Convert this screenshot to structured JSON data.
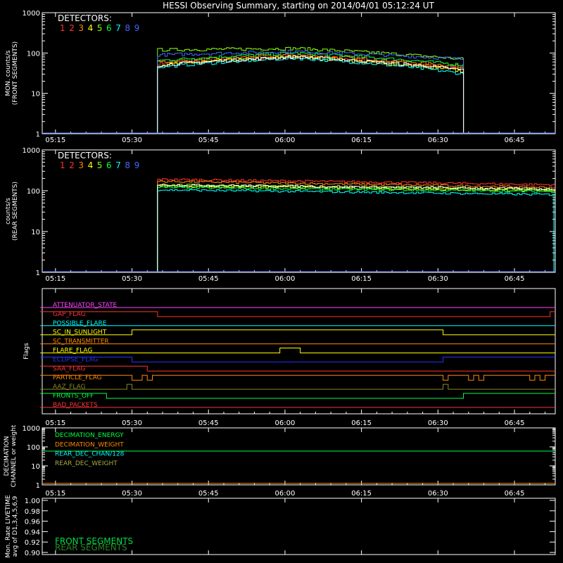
{
  "title": "HESSI Observing Summary, starting on 2014/04/01 05:12:24 UT",
  "colors": {
    "background": "#000000",
    "frame": "#ffffff",
    "detectors": [
      "#ff3333",
      "#ff3333",
      "#ff8800",
      "#ffff00",
      "#88ff00",
      "#00ff44",
      "#00ffff",
      "#4466ff",
      "#4466ff"
    ]
  },
  "time_ticks": [
    "05:15",
    "05:30",
    "05:45",
    "06:00",
    "06:15",
    "06:30",
    "06:45"
  ],
  "front_panel": {
    "ylabel_line1": "MON. counts/s",
    "ylabel_line2": "(FRONT SEGMENTS)",
    "yticks": [
      "1000",
      "100",
      "10",
      "1"
    ],
    "legend_title": "DETECTORS:",
    "detector_numbers": [
      "1",
      "2",
      "3",
      "4",
      "5",
      "6",
      "7",
      "8",
      "9"
    ],
    "chart_data": {
      "type": "line",
      "x_range": [
        "05:12",
        "06:53"
      ],
      "ylim": [
        1,
        1000
      ],
      "log_scale": true,
      "data_start": "05:35",
      "data_end": "06:35",
      "series_levels": [
        {
          "color": "#ff3333",
          "start": 55,
          "peak": 85,
          "end": 40
        },
        {
          "color": "#ff8800",
          "start": 60,
          "peak": 90,
          "end": 45
        },
        {
          "color": "#ffff00",
          "start": 50,
          "peak": 80,
          "end": 35
        },
        {
          "color": "#88ff00",
          "start": 120,
          "peak": 130,
          "end": 70
        },
        {
          "color": "#00ff44",
          "start": 65,
          "peak": 100,
          "end": 50
        },
        {
          "color": "#00ffff",
          "start": 45,
          "peak": 75,
          "end": 30
        },
        {
          "color": "#4466ff",
          "start": 90,
          "peak": 110,
          "end": 70
        },
        {
          "color": "#ffffff",
          "start": 50,
          "peak": 80,
          "end": 38
        }
      ]
    }
  },
  "rear_panel": {
    "ylabel_line1": "counts/s",
    "ylabel_line2": "(REAR SEGMENTS)",
    "yticks": [
      "1000",
      "100",
      "10",
      "1"
    ],
    "legend_title": "DETECTORS:",
    "detector_numbers": [
      "1",
      "2",
      "3",
      "4",
      "5",
      "6",
      "7",
      "8",
      "9"
    ],
    "chart_data": {
      "type": "line",
      "x_range": [
        "05:12",
        "06:53"
      ],
      "ylim": [
        1,
        1000
      ],
      "log_scale": true,
      "data_start": "05:35",
      "series_levels": [
        {
          "color": "#ff3333",
          "start": 190,
          "end": 140
        },
        {
          "color": "#ff8800",
          "start": 170,
          "end": 120
        },
        {
          "color": "#ffff00",
          "start": 130,
          "end": 100
        },
        {
          "color": "#88ff00",
          "start": 140,
          "end": 105
        },
        {
          "color": "#00ff44",
          "start": 120,
          "end": 95
        },
        {
          "color": "#00ffff",
          "start": 105,
          "end": 80
        },
        {
          "color": "#ffffff",
          "start": 140,
          "end": 110
        }
      ]
    }
  },
  "flags_panel": {
    "ylabel": "Flags",
    "flags": [
      {
        "label": "ATTENUATOR_STATE",
        "color": "#ff44ff",
        "segments": [
          [
            "05:12",
            "06:53",
            0
          ]
        ]
      },
      {
        "label": "GAP_FLAG",
        "color": "#ff3333",
        "segments": [
          [
            "05:12",
            "05:35",
            1
          ],
          [
            "05:35",
            "06:52",
            0
          ],
          [
            "06:52",
            "06:53",
            1
          ]
        ]
      },
      {
        "label": "POSSIBLE_FLARE",
        "color": "#00ffff",
        "segments": [
          [
            "05:12",
            "06:53",
            0
          ]
        ]
      },
      {
        "label": "SC_IN_SUNLIGHT",
        "color": "#ffff00",
        "segments": [
          [
            "05:12",
            "05:30",
            0
          ],
          [
            "05:30",
            "06:31",
            1
          ],
          [
            "06:31",
            "06:53",
            0
          ]
        ]
      },
      {
        "label": "SC_TRANSMITTER",
        "color": "#ff8800",
        "segments": [
          [
            "05:12",
            "06:53",
            0
          ]
        ]
      },
      {
        "label": "FLARE_FLAG",
        "color": "#ffff00",
        "segments": [
          [
            "05:12",
            "05:59",
            0
          ],
          [
            "05:59",
            "06:03",
            1
          ],
          [
            "06:03",
            "06:53",
            0
          ]
        ]
      },
      {
        "label": "ECLIPSE_FLAG",
        "color": "#2233ff",
        "segments": [
          [
            "05:12",
            "05:30",
            1
          ],
          [
            "05:30",
            "06:31",
            0
          ],
          [
            "06:31",
            "06:53",
            1
          ]
        ]
      },
      {
        "label": "SAA_FLAG",
        "color": "#ff3333",
        "segments": [
          [
            "05:12",
            "05:33",
            1
          ],
          [
            "05:33",
            "06:53",
            0
          ]
        ]
      },
      {
        "label": "PARTICLE_FLAG",
        "color": "#ff8800",
        "segments": [
          [
            "05:12",
            "05:30",
            1
          ],
          [
            "05:30",
            "05:32",
            0
          ],
          [
            "05:32",
            "05:33",
            1
          ],
          [
            "05:33",
            "05:34",
            0
          ],
          [
            "05:34",
            "06:31",
            1
          ],
          [
            "06:31",
            "06:32",
            0
          ],
          [
            "06:32",
            "06:36",
            1
          ],
          [
            "06:36",
            "06:37",
            0
          ],
          [
            "06:37",
            "06:38",
            1
          ],
          [
            "06:38",
            "06:39",
            0
          ],
          [
            "06:39",
            "06:40",
            1
          ],
          [
            "06:40",
            "06:48",
            1
          ],
          [
            "06:48",
            "06:49",
            0
          ],
          [
            "06:49",
            "06:50",
            1
          ],
          [
            "06:50",
            "06:51",
            0
          ],
          [
            "06:51",
            "06:53",
            1
          ]
        ]
      },
      {
        "label": "AAZ_FLAG",
        "color": "#888822",
        "segments": [
          [
            "05:12",
            "05:29",
            0
          ],
          [
            "05:29",
            "05:30",
            1
          ],
          [
            "05:30",
            "06:31",
            0
          ],
          [
            "06:31",
            "06:32",
            1
          ],
          [
            "06:32",
            "06:53",
            0
          ]
        ]
      },
      {
        "label": "FRONTS_OFF",
        "color": "#00ff44",
        "segments": [
          [
            "05:12",
            "05:25",
            1
          ],
          [
            "05:25",
            "06:35",
            0
          ],
          [
            "06:35",
            "06:53",
            1
          ]
        ]
      },
      {
        "label": "BAD_PACKETS",
        "color": "#ff3333",
        "segments": [
          [
            "05:12",
            "06:53",
            0
          ]
        ]
      }
    ]
  },
  "decimation_panel": {
    "ylabel_line1": "DECIMATION",
    "ylabel_line2": "CHANNEL or weight",
    "yticks": [
      "1000",
      "100",
      "10",
      "1"
    ],
    "legend": [
      {
        "label": "DECIMATION_ENERGY",
        "color": "#00ff44"
      },
      {
        "label": "DECIMATION_WEIGHT",
        "color": "#ff8800"
      },
      {
        "label": "REAR_DEC_CHAN/128",
        "color": "#00ffff"
      },
      {
        "label": "REAR_DEC_WEIGHT",
        "color": "#aaaa44"
      }
    ],
    "chart_data": {
      "type": "line",
      "ylim": [
        1,
        1000
      ],
      "log_scale": true,
      "series": [
        {
          "name": "DECIMATION_ENERGY",
          "color": "#00ff44",
          "value": 60
        },
        {
          "name": "DECIMATION_WEIGHT",
          "color": "#ff8800",
          "value": 1.2
        }
      ]
    }
  },
  "livetime_panel": {
    "ylabel_line1": "Mon. Rate LIVETIME",
    "ylabel_line2": "avg of D1,3,4,5,6,9",
    "yticks": [
      "1.00",
      "0.98",
      "0.96",
      "0.94",
      "0.92",
      "0.90"
    ],
    "legend": [
      {
        "label": "FRONT SEGMENTS",
        "color": "#00dd44"
      },
      {
        "label": "REAR SEGMENTS",
        "color": "#228822"
      }
    ]
  }
}
